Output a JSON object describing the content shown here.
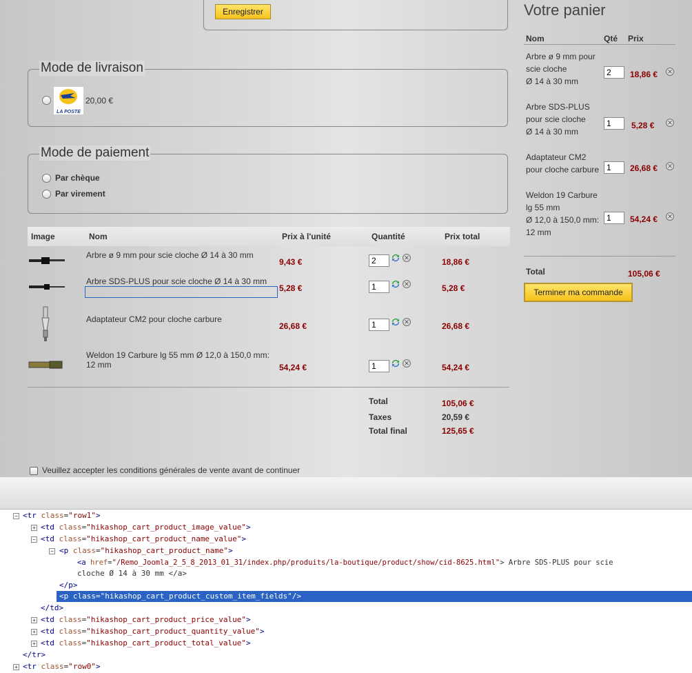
{
  "top_form": {
    "save_button": "Enregistrer"
  },
  "shipping": {
    "legend": "Mode de livraison",
    "option_logo_text": "LA POSTE",
    "option_price": "20,00 €"
  },
  "payment": {
    "legend": "Mode de paiement",
    "options": [
      "Par chèque",
      "Par virement"
    ]
  },
  "cart_table": {
    "headers": {
      "image": "Image",
      "name": "Nom",
      "unit_price": "Prix à l'unité",
      "quantity": "Quantité",
      "total_price": "Prix total"
    },
    "rows": [
      {
        "name": "Arbre ø 9 mm pour scie cloche Ø 14 à 30 mm",
        "unit_price": "9,43 €",
        "quantity": "2",
        "total": "18,86 €"
      },
      {
        "name": "Arbre SDS-PLUS pour scie cloche Ø 14 à 30 mm",
        "unit_price": "5,28 €",
        "quantity": "1",
        "total": "5,28 €"
      },
      {
        "name": "Adaptateur CM2 pour cloche carbure",
        "unit_price": "26,68 €",
        "quantity": "1",
        "total": "26,68 €"
      },
      {
        "name": "Weldon 19 Carbure lg 55 mm Ø 12,0 à 150,0 mm: 12 mm",
        "unit_price": "54,24 €",
        "quantity": "1",
        "total": "54,24 €"
      }
    ],
    "summary": {
      "total_label": "Total",
      "total_value": "105,06 €",
      "tax_label": "Taxes",
      "tax_value": "20,59 €",
      "final_label": "Total final",
      "final_value": "125,65 €"
    }
  },
  "terms": {
    "label": "Veuillez accepter les conditions générales de vente avant de continuer"
  },
  "side_cart": {
    "title": "Votre panier",
    "headers": {
      "name": "Nom",
      "qty": "Qté",
      "price": "Prix"
    },
    "items": [
      {
        "line1": "Arbre ø 9 mm pour",
        "line2": "scie cloche",
        "line3": "Ø 14 à 30 mm",
        "qty": "2",
        "price": "18,86 €"
      },
      {
        "line1": "Arbre SDS-PLUS",
        "line2": "pour scie cloche",
        "line3": "Ø 14 à 30 mm",
        "qty": "1",
        "price": "5,28 €"
      },
      {
        "line1": "Adaptateur CM2",
        "line2": "pour cloche carbure",
        "line3": "",
        "qty": "1",
        "price": "26,68 €"
      },
      {
        "line1": "Weldon 19 Carbure",
        "line2": "lg 55 mm",
        "line3": "Ø 12,0 à 150,0 mm:",
        "line4": "12 mm",
        "qty": "1",
        "price": "54,24 €"
      }
    ],
    "total_label": "Total",
    "total_value": "105,06 €",
    "checkout_button": "Terminer ma commande"
  },
  "devtools": {
    "lines": [
      {
        "pre": "<tr ",
        "attr": "class",
        "val": "\"row1\"",
        "post": ">"
      },
      {
        "pre": "<td ",
        "attr": "class",
        "val": "\"hikashop_cart_product_image_value\"",
        "post": ">"
      },
      {
        "pre": "<td ",
        "attr": "class",
        "val": "\"hikashop_cart_product_name_value\"",
        "post": ">"
      },
      {
        "pre": "<p ",
        "attr": "class",
        "val": "\"hikashop_cart_product_name\"",
        "post": ">"
      },
      {
        "pre": "<a ",
        "attr": "href",
        "val": "\"/Remo_Joomla_2_5_8_2013_01_31/index.php/produits/la-boutique/product/show/cid-8625.html\"",
        "post": "> Arbre SDS-PLUS pour scie"
      },
      {
        "text": "cloche Ø 14 à 30 mm </a>"
      },
      {
        "text": "</p>"
      },
      {
        "text": "<p class=\"hikashop_cart_product_custom_item_fields\"/>"
      },
      {
        "text": "</td>"
      },
      {
        "pre": "<td ",
        "attr": "class",
        "val": "\"hikashop_cart_product_price_value\"",
        "post": ">"
      },
      {
        "pre": "<td ",
        "attr": "class",
        "val": "\"hikashop_cart_product_quantity_value\"",
        "post": ">"
      },
      {
        "pre": "<td ",
        "attr": "class",
        "val": "\"hikashop_cart_product_total_value\"",
        "post": ">"
      },
      {
        "text": "</tr>"
      },
      {
        "pre": "<tr ",
        "attr": "class",
        "val": "\"row0\"",
        "post": ">"
      }
    ]
  }
}
